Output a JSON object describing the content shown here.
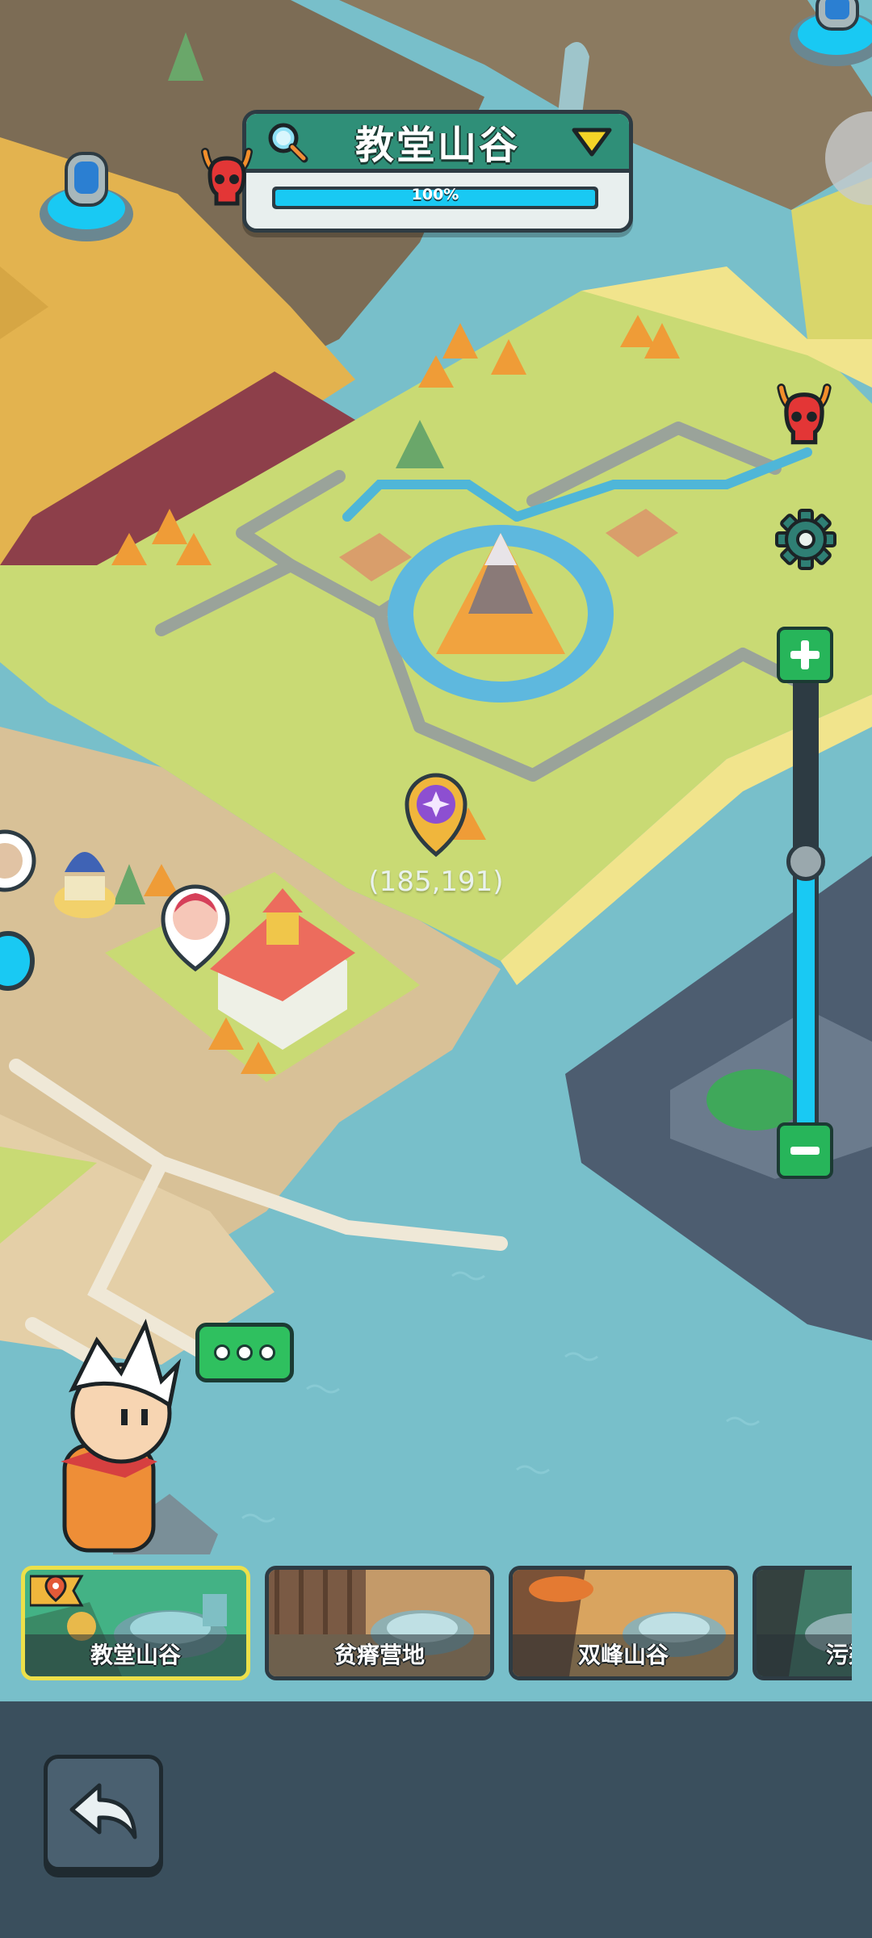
{
  "region": {
    "name": "教堂山谷",
    "progress_text": "100%",
    "progress": 1.0
  },
  "map": {
    "coordinates": "(185,191)"
  },
  "zoom": {
    "level": 0.6
  },
  "colors": {
    "accent_cyan": "#19c9f3",
    "header_green": "#2f8f78",
    "button_green": "#27b55a",
    "bottom_bar": "#3a4f5d",
    "active_card_border": "#ece04a"
  },
  "icons": {
    "search": "magnifier-icon",
    "dropdown": "triangle-down-icon",
    "settings": "gear-icon",
    "enemy": "demon-skull-icon",
    "back": "back-arrow-icon",
    "zoom_in": "plus-icon",
    "zoom_out": "minus-icon",
    "chat": "ellipsis-chat-icon"
  },
  "regions": [
    {
      "label": "教堂山谷",
      "active": true
    },
    {
      "label": "贫瘠营地",
      "active": false
    },
    {
      "label": "双峰山谷",
      "active": false
    },
    {
      "label": "污染",
      "active": false
    }
  ]
}
